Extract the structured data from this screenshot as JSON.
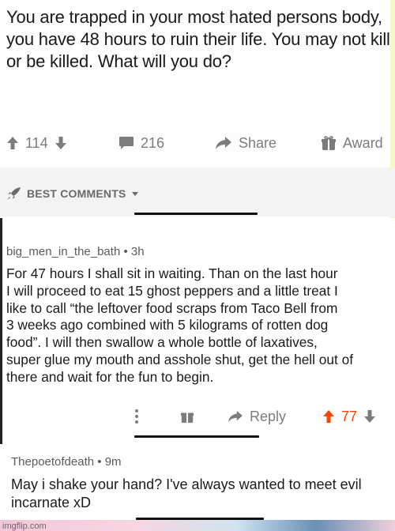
{
  "post": {
    "title": "You are trapped in your most hated persons body, you have 48 hours to ruin their life. You may not kill or be killed. What will you do?",
    "votes": "114",
    "comments": "216",
    "share_label": "Share",
    "award_label": "Award",
    "best_comments_label": "BEST COMMENTS"
  },
  "comment1": {
    "user": "big_men_in_the_bath",
    "age": "3h",
    "text": "For 47 hours I shall sit in waiting. Than on the last hour\nI  will proceed to eat 15 ghost peppers and a little treat I\nlike to call “the leftover food scraps from Taco Bell from\n3 weeks ago combined with 5 kilograms of rotten dog\nfood”. I will then swallow a whole bottle of laxatives,\nsuper glue my mouth and asshole shut, get the hell out of\nthere and wait for the fun to begin.",
    "reply_label": "Reply",
    "votes": "77"
  },
  "comment2": {
    "user": "Thepoetofdeath",
    "age": "9m",
    "text": "May i shake your hand? I've always wanted to meet evil incarnate xD"
  },
  "watermark": "imgflip.com",
  "colors": {
    "upvote_active": "#ff4500",
    "icon_grey": "#7c7c7c"
  }
}
